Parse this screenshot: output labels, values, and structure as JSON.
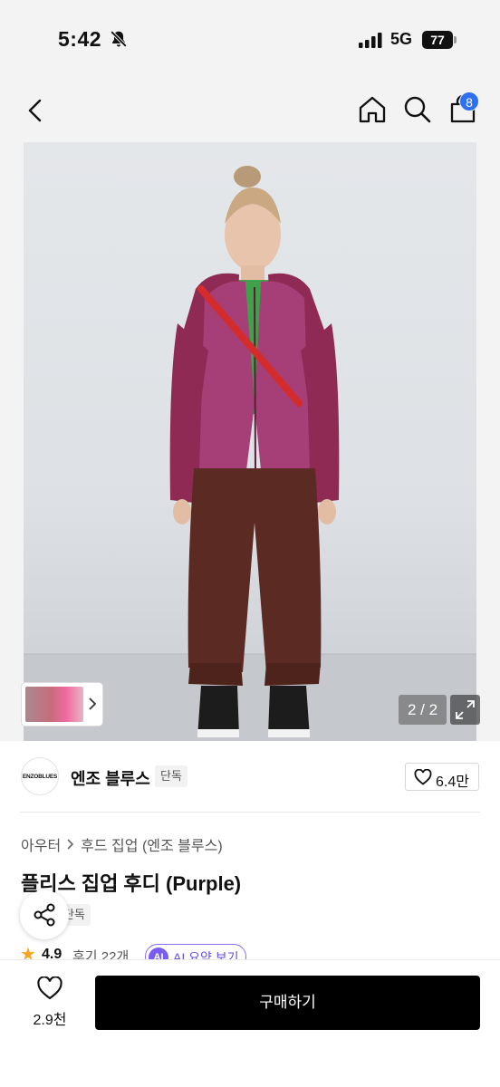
{
  "status_bar": {
    "time": "5:42",
    "network": "5G",
    "battery": "77"
  },
  "nav": {
    "cart_count": "8"
  },
  "gallery": {
    "page_indicator": "2 / 2"
  },
  "brand": {
    "logo_text": "ENZOBLUES",
    "name": "엔조 블루스",
    "tag": "단독",
    "likes": "6.4만"
  },
  "breadcrumb": {
    "category": "아우터",
    "subcategory": "후드 집업 (엔조 블루스)"
  },
  "product": {
    "title": "플리스 집업 후디 (Purple)",
    "tag": "단독",
    "rating": "4.9",
    "reviews": "후기 22개",
    "ai_badge": "AI",
    "ai_summary": "AI 요약 보기"
  },
  "bottom_bar": {
    "wish_count": "2.9천",
    "buy_label": "구매하기"
  },
  "colors": {
    "accent": "#2f6ff2",
    "ai_purple": "#7b5cf0",
    "star": "#f5a623",
    "buy_button": "#000000"
  },
  "icons": [
    "bell-slash-icon",
    "signal-icon",
    "battery-icon",
    "back-icon",
    "home-icon",
    "search-icon",
    "bag-icon",
    "chevron-right-icon",
    "expand-icon",
    "heart-icon",
    "share-icon",
    "star-icon"
  ]
}
